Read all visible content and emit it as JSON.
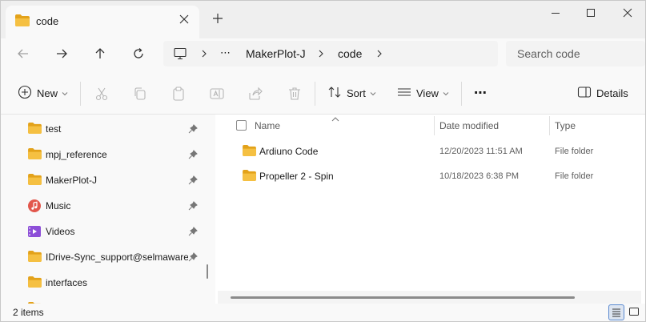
{
  "window": {
    "tab_title": "code"
  },
  "address": {
    "ellipsis": "⋯",
    "crumbs": [
      "MakerPlot-J",
      "code"
    ]
  },
  "search": {
    "placeholder": "Search code"
  },
  "toolbar": {
    "new_label": "New",
    "sort_label": "Sort",
    "view_label": "View",
    "more_label": "⋯",
    "details_label": "Details"
  },
  "nav": {
    "items": [
      {
        "label": "test",
        "icon": "folder-icon",
        "pinned": true
      },
      {
        "label": "mpj_reference",
        "icon": "folder-icon",
        "pinned": true
      },
      {
        "label": "MakerPlot-J",
        "icon": "folder-icon",
        "pinned": true
      },
      {
        "label": "Music",
        "icon": "music-icon",
        "pinned": true
      },
      {
        "label": "Videos",
        "icon": "video-icon",
        "pinned": true
      },
      {
        "label": "IDrive-Sync_support@selmaware.",
        "icon": "folder-icon",
        "pinned": true
      },
      {
        "label": "interfaces",
        "icon": "folder-icon",
        "pinned": false
      }
    ]
  },
  "columns": {
    "name": "Name",
    "date_modified": "Date modified",
    "type": "Type"
  },
  "files": [
    {
      "name": "Ardiuno Code",
      "date": "12/20/2023 11:51 AM",
      "type": "File folder"
    },
    {
      "name": "Propeller 2 - Spin",
      "date": "10/18/2023 6:38 PM",
      "type": "File folder"
    }
  ],
  "status": {
    "item_count": "2 items"
  },
  "colors": {
    "folder": "#f5c042",
    "folder_dark": "#e3a21a",
    "accent": "#005fb8"
  }
}
